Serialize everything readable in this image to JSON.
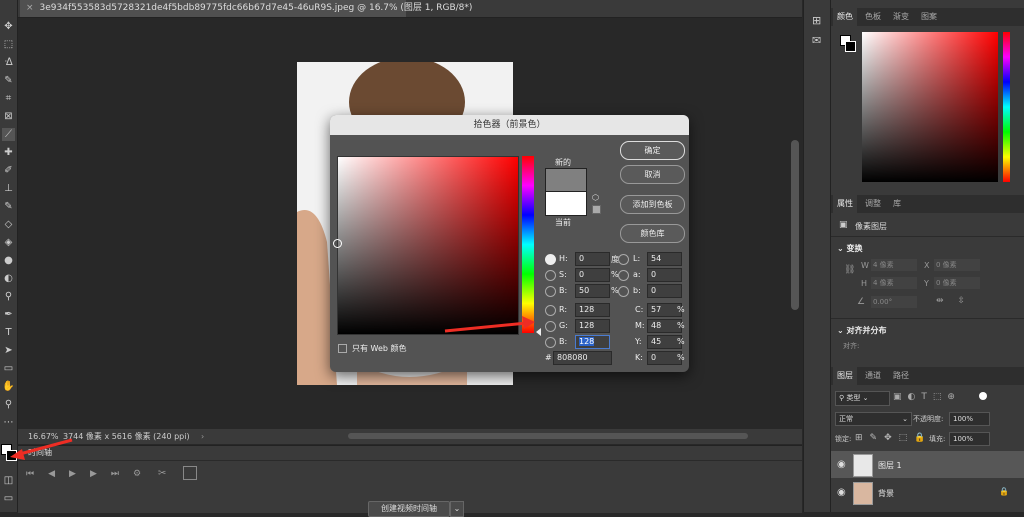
{
  "document": {
    "tab_title": "3e934f553583d5728321de4f5bdb89775fdc66b67d7e45-46uR9S.jpeg @ 16.7% (图层 1, RGB/8*)",
    "tab_close": "×"
  },
  "status": {
    "zoom": "16.67%",
    "info": "3744 像素 x 5616 像素 (240 ppi)"
  },
  "timeline": {
    "title": "时间轴",
    "create_button": "创建视频时间轴"
  },
  "color_picker": {
    "title": "拾色器（前景色）",
    "new_label": "新的",
    "current_label": "当前",
    "ok": "确定",
    "cancel": "取消",
    "add_swatch": "添加到色板",
    "color_library": "颜色库",
    "web_only": "只有 Web 颜色",
    "H": {
      "label": "H:",
      "value": "0",
      "unit": "度"
    },
    "S": {
      "label": "S:",
      "value": "0",
      "unit": "%"
    },
    "Bh": {
      "label": "B:",
      "value": "50",
      "unit": "%"
    },
    "R": {
      "label": "R:",
      "value": "128"
    },
    "G": {
      "label": "G:",
      "value": "128"
    },
    "Bb": {
      "label": "B:",
      "value": "128"
    },
    "L": {
      "label": "L:",
      "value": "54"
    },
    "a": {
      "label": "a:",
      "value": "0"
    },
    "b": {
      "label": "b:",
      "value": "0"
    },
    "C": {
      "label": "C:",
      "value": "57",
      "unit": "%"
    },
    "M": {
      "label": "M:",
      "value": "48",
      "unit": "%"
    },
    "Y": {
      "label": "Y:",
      "value": "45",
      "unit": "%"
    },
    "K": {
      "label": "K:",
      "value": "0",
      "unit": "%"
    },
    "hex_label": "#",
    "hex": "808080",
    "new_color": "#808080",
    "current_color": "#ffffff",
    "hue_color": "#ff0000"
  },
  "panels": {
    "color_tabs": [
      "颜色",
      "色板",
      "渐变",
      "图案"
    ],
    "props_tabs": [
      "属性",
      "调整",
      "库"
    ],
    "pixel_layer": "像素图层",
    "transform": "变换",
    "W": "W",
    "H": "H",
    "X": "X",
    "Y": "Y",
    "w_val": "4 像素",
    "h_val": "4 像素",
    "x_val": "0 像素",
    "y_val": "0 像素",
    "angle_val": "0.00°",
    "align": "对齐并分布",
    "align_sub": "对齐:",
    "layers_tabs": [
      "图层",
      "通道",
      "路径"
    ],
    "kind": "类型",
    "blend": "正常",
    "opacity_label": "不透明度:",
    "opacity": "100%",
    "lock_label": "锁定:",
    "fill_label": "填充:",
    "fill": "100%",
    "layers": [
      {
        "name": "图层 1"
      },
      {
        "name": "背景"
      }
    ]
  }
}
